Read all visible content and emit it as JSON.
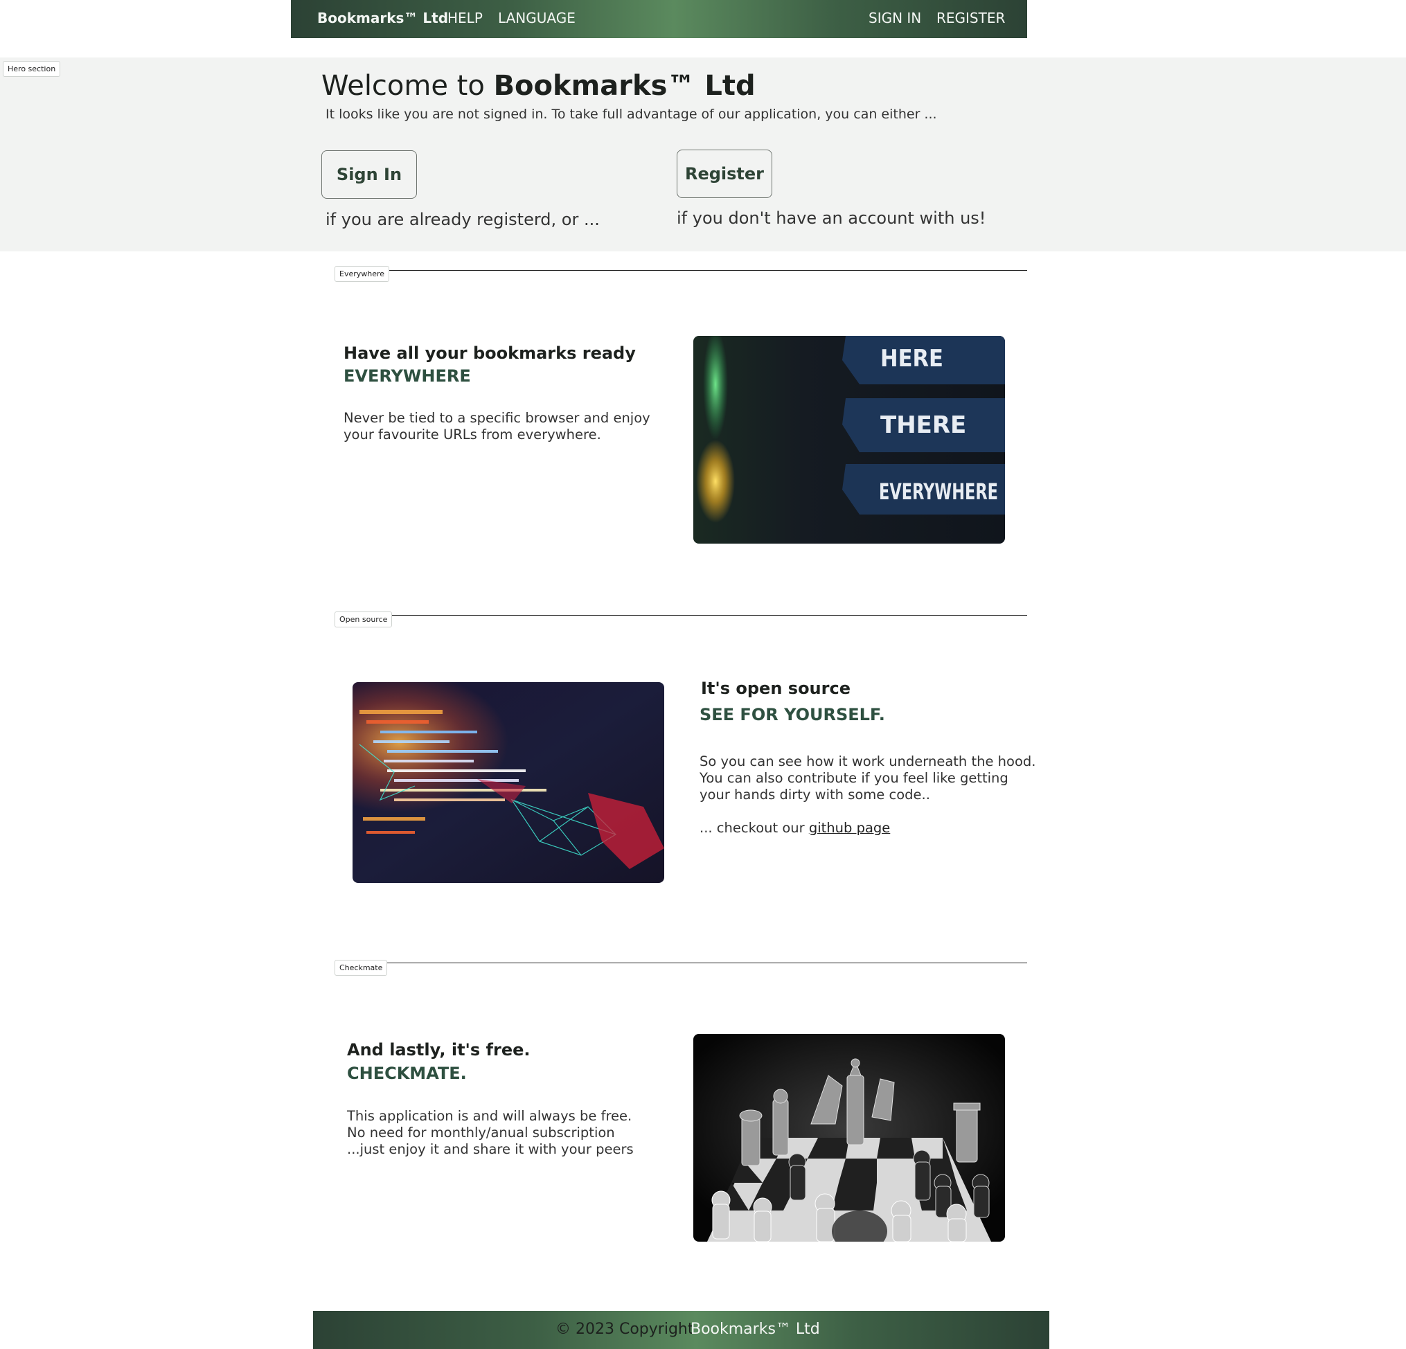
{
  "navbar": {
    "brand": "Bookmarks™ Ltd",
    "help": "HELP",
    "language": "LANGUAGE",
    "sign_in": "SIGN IN",
    "register": "REGISTER"
  },
  "hero": {
    "tag": "Hero section",
    "title_prefix": "Welcome to",
    "title_brand": "Bookmarks™ Ltd",
    "subtitle": "It looks like you are not signed in. To take full advantage of our application, you can either ...",
    "sign_in_button": "Sign In",
    "sign_in_note": "if you are already registerd, or ...",
    "register_button": "Register",
    "register_note": "if you don't have an account with us!"
  },
  "sections": {
    "everywhere": {
      "tag": "Everywhere",
      "title": "Have all your bookmarks ready",
      "accent": "EVERYWHERE",
      "body": [
        "Never be tied to a specific browser and enjoy",
        "your favourite URLs from everywhere."
      ],
      "image_signs": [
        "HERE",
        "THERE",
        "EVERYWHERE"
      ]
    },
    "open_source": {
      "tag": "Open source",
      "title": "It's open source",
      "accent": "SEE FOR YOURSELF.",
      "body": [
        "So you can see how it work underneath the hood.",
        "You can also contribute if you feel like getting",
        "your hands dirty with some code.."
      ],
      "checkout_prefix": "... checkout our",
      "link_text": "github page"
    },
    "checkmate": {
      "tag": "Checkmate",
      "title": "And lastly, it's free.",
      "accent": "CHECKMATE.",
      "body": [
        "This application is and will always be free.",
        "No need for monthly/anual subscription",
        "...just enjoy it and share it with your peers"
      ]
    }
  },
  "footer": {
    "copyright": "© 2023 Copyright",
    "brand": "Bookmarks™ Ltd"
  },
  "colors": {
    "accent_green": "#2e5040",
    "nav_gradient_dark": "#2c4235",
    "nav_gradient_light": "#5b8a5e",
    "hero_bg": "#f2f3f2"
  }
}
